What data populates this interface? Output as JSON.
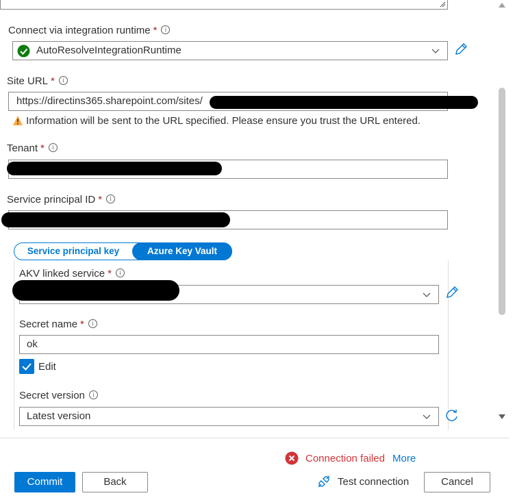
{
  "top_textarea": {
    "value": ""
  },
  "connect_runtime": {
    "label": "Connect via integration runtime",
    "value": "AutoResolveIntegrationRuntime"
  },
  "site_url": {
    "label": "Site URL",
    "value": "https://directins365.sharepoint.com/sites/",
    "warning": "Information will be sent to the URL specified. Please ensure you trust the URL entered."
  },
  "tenant": {
    "label": "Tenant",
    "value": ""
  },
  "service_principal_id": {
    "label": "Service principal ID",
    "value": ""
  },
  "auth_tabs": {
    "tab1": "Service principal key",
    "tab2": "Azure Key Vault",
    "selected": "Azure Key Vault"
  },
  "akv_linked_service": {
    "label": "AKV linked service",
    "value": ""
  },
  "secret_name": {
    "label": "Secret name",
    "value": "ok",
    "edit_label": "Edit",
    "edit_checked": true
  },
  "secret_version": {
    "label": "Secret version",
    "value": "Latest version"
  },
  "status": {
    "text": "Connection failed",
    "more": "More",
    "color": "#d13438"
  },
  "footer": {
    "commit": "Commit",
    "back": "Back",
    "test_connection": "Test connection",
    "cancel": "Cancel"
  },
  "colors": {
    "accent": "#0078d4",
    "success": "#107c10",
    "warning": "#ffaa44",
    "error": "#d13438"
  }
}
